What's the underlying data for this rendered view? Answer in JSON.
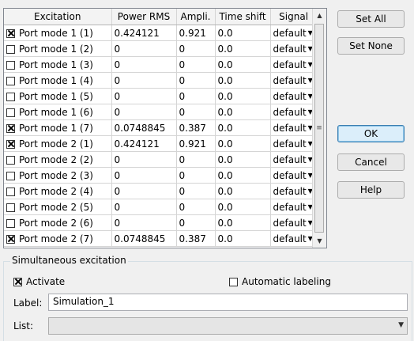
{
  "table": {
    "headers": [
      "Excitation",
      "Power RMS",
      "Ampli.",
      "Time shift",
      "Signal"
    ],
    "rows": [
      {
        "checked": true,
        "excitation": "Port mode 1 (1)",
        "power": "0.424121",
        "ampli": "0.921",
        "shift": "0.0",
        "signal": "default"
      },
      {
        "checked": false,
        "excitation": "Port mode 1 (2)",
        "power": "0",
        "ampli": "0",
        "shift": "0.0",
        "signal": "default"
      },
      {
        "checked": false,
        "excitation": "Port mode 1 (3)",
        "power": "0",
        "ampli": "0",
        "shift": "0.0",
        "signal": "default"
      },
      {
        "checked": false,
        "excitation": "Port mode 1 (4)",
        "power": "0",
        "ampli": "0",
        "shift": "0.0",
        "signal": "default"
      },
      {
        "checked": false,
        "excitation": "Port mode 1 (5)",
        "power": "0",
        "ampli": "0",
        "shift": "0.0",
        "signal": "default"
      },
      {
        "checked": false,
        "excitation": "Port mode 1 (6)",
        "power": "0",
        "ampli": "0",
        "shift": "0.0",
        "signal": "default"
      },
      {
        "checked": true,
        "excitation": "Port mode 1 (7)",
        "power": "0.0748845",
        "ampli": "0.387",
        "shift": "0.0",
        "signal": "default"
      },
      {
        "checked": true,
        "excitation": "Port mode 2 (1)",
        "power": "0.424121",
        "ampli": "0.921",
        "shift": "0.0",
        "signal": "default"
      },
      {
        "checked": false,
        "excitation": "Port mode 2 (2)",
        "power": "0",
        "ampli": "0",
        "shift": "0.0",
        "signal": "default"
      },
      {
        "checked": false,
        "excitation": "Port mode 2 (3)",
        "power": "0",
        "ampli": "0",
        "shift": "0.0",
        "signal": "default"
      },
      {
        "checked": false,
        "excitation": "Port mode 2 (4)",
        "power": "0",
        "ampli": "0",
        "shift": "0.0",
        "signal": "default"
      },
      {
        "checked": false,
        "excitation": "Port mode 2 (5)",
        "power": "0",
        "ampli": "0",
        "shift": "0.0",
        "signal": "default"
      },
      {
        "checked": false,
        "excitation": "Port mode 2 (6)",
        "power": "0",
        "ampli": "0",
        "shift": "0.0",
        "signal": "default"
      },
      {
        "checked": true,
        "excitation": "Port mode 2 (7)",
        "power": "0.0748845",
        "ampli": "0.387",
        "shift": "0.0",
        "signal": "default"
      }
    ]
  },
  "buttons": {
    "set_all": "Set All",
    "set_none": "Set None",
    "ok": "OK",
    "cancel": "Cancel",
    "help": "Help"
  },
  "simultaneous": {
    "group_title": "Simultaneous excitation",
    "activate_label": "Activate",
    "activate_checked": true,
    "auto_label": "Automatic labeling",
    "auto_checked": false,
    "label_caption": "Label:",
    "label_value": "Simulation_1",
    "list_caption": "List:",
    "list_value": ""
  }
}
